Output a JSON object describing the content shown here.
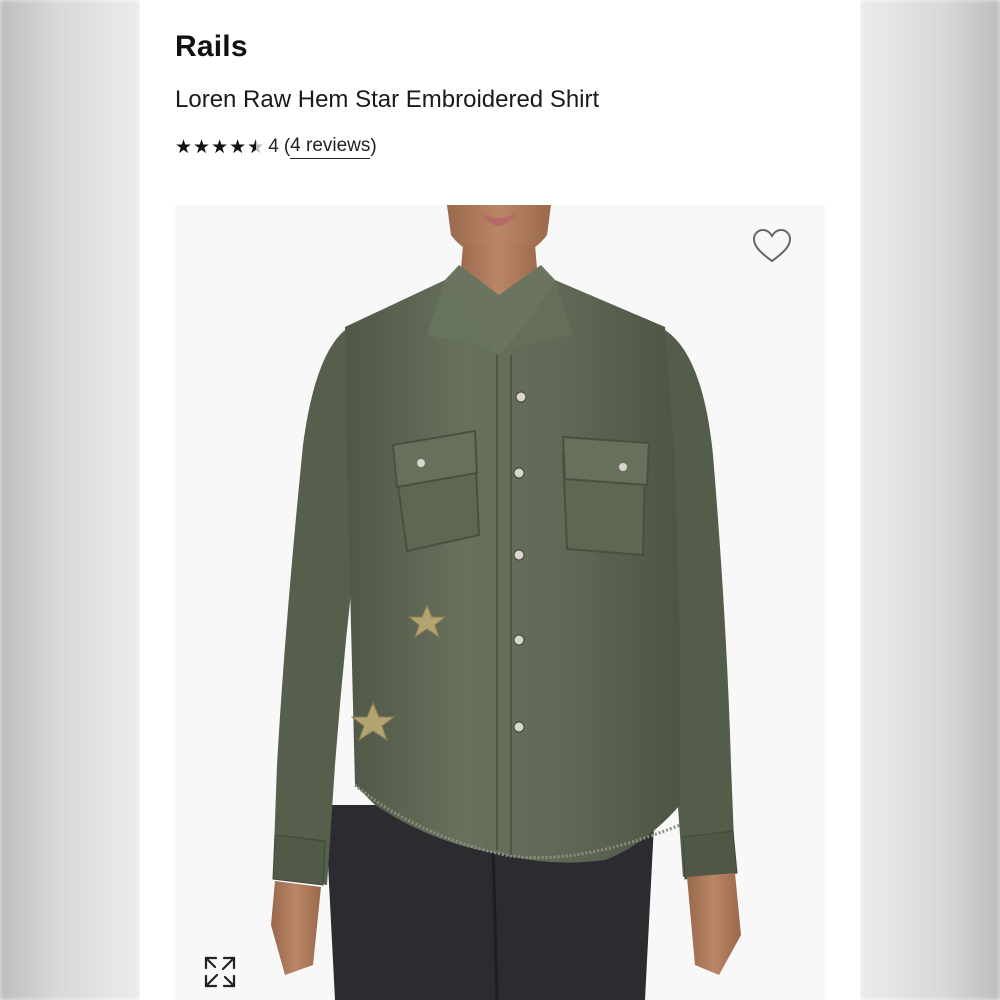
{
  "product": {
    "brand": "Rails",
    "name": "Loren Raw Hem Star Embroidered Shirt",
    "rating": {
      "stars_filled": 4,
      "stars_half": 1,
      "value": "4",
      "open_paren": "(",
      "reviews_text": "4 reviews",
      "close_paren": ")"
    }
  },
  "image": {
    "alt": "Woman wearing olive green button-up shirt with gold embroidered stars and raw frayed hem",
    "colors": {
      "shirt": "#606a56",
      "shirt_shadow": "#4c5544",
      "jeans": "#2b2b30",
      "skin": "#b07c5e",
      "star_embroidery": "#b3a371"
    }
  },
  "icons": {
    "favorite": "heart-outline-icon",
    "expand": "expand-arrows-icon",
    "star": "star-icon"
  }
}
